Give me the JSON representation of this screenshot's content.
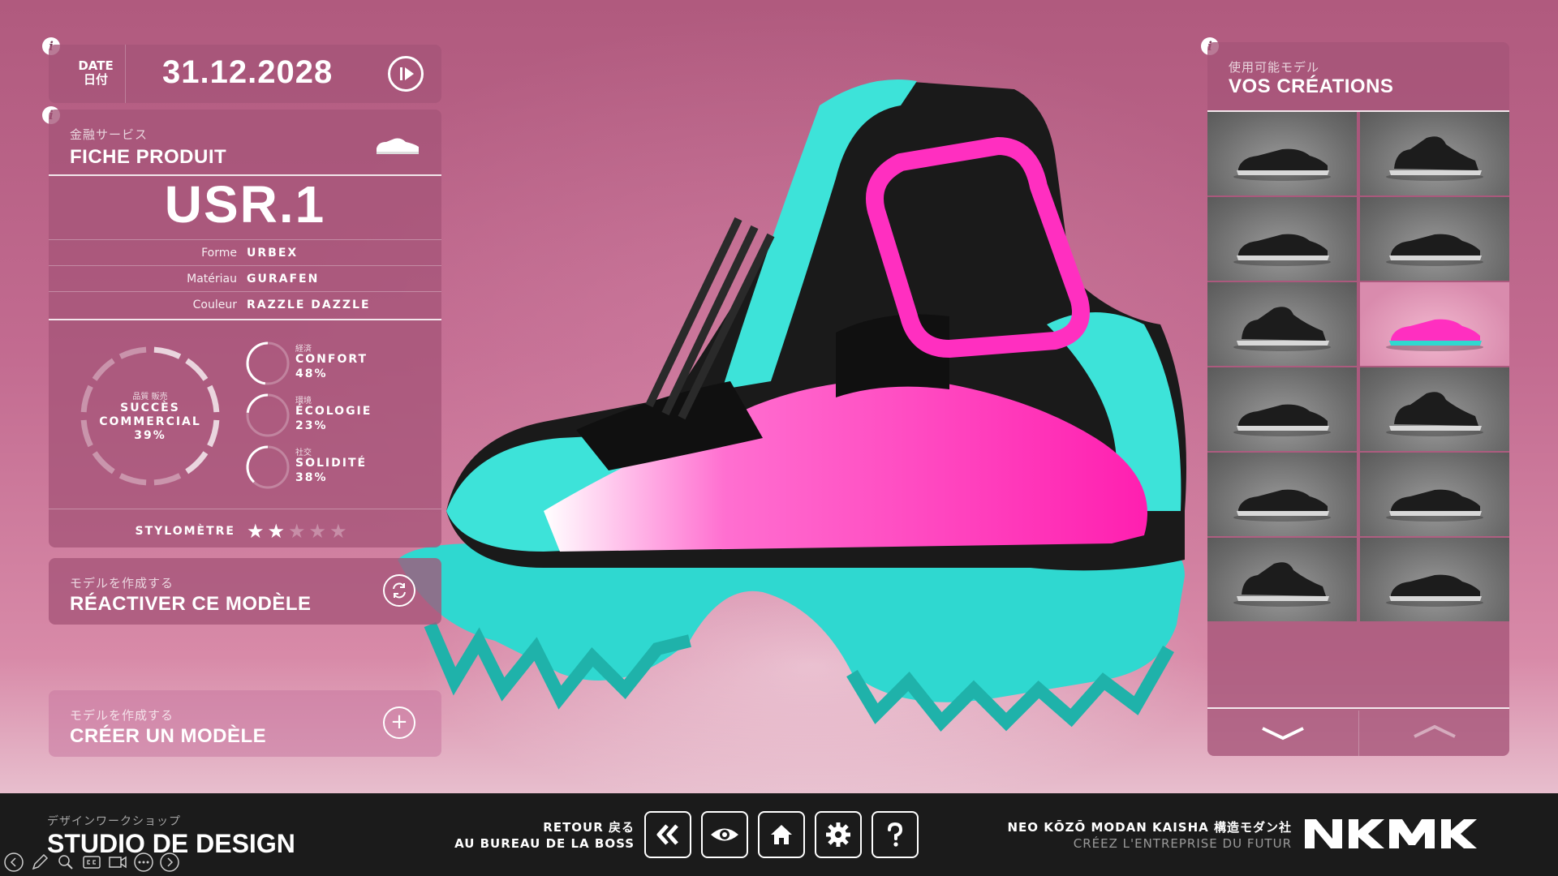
{
  "date": {
    "label": "DATE",
    "label_jp": "日付",
    "value": "31.12.2028"
  },
  "product": {
    "subtitle_jp": "金融サービス",
    "title": "FICHE PRODUIT",
    "model_name": "USR.1",
    "attributes": [
      {
        "key": "Forme",
        "value": "URBEX"
      },
      {
        "key": "Matériau",
        "value": "GURAFEN"
      },
      {
        "key": "Couleur",
        "value": "RAZZLE DAZZLE"
      }
    ],
    "main_stat": {
      "jp": "品質 販売",
      "line1": "SUCCÈS",
      "line2": "COMMERCIAL",
      "percent_label": "39%",
      "value": 39
    },
    "stats": [
      {
        "jp": "経済",
        "name": "CONFORT",
        "percent_label": "48%",
        "value": 48
      },
      {
        "jp": "環境",
        "name": "ÉCOLOGIE",
        "percent_label": "23%",
        "value": 23
      },
      {
        "jp": "社交",
        "name": "SOLIDITÉ",
        "percent_label": "38%",
        "value": 38
      }
    ],
    "stylometer": {
      "label": "STYLOMÈTRE",
      "rating": 2,
      "max": 5
    }
  },
  "reactivate": {
    "jp": "モデルを作成する",
    "label": "RÉACTIVER CE MODÈLE",
    "icon": "refresh-icon"
  },
  "create": {
    "jp": "モデルを作成する",
    "label": "CRÉER UN MODÈLE",
    "icon": "plus-icon"
  },
  "creations": {
    "jp": "使用可能モデル",
    "title": "VOS CRÉATIONS",
    "selected_index": 5,
    "count": 12
  },
  "bottom": {
    "studio_jp": "デザインワークショップ",
    "studio": "STUDIO DE DESIGN",
    "back_line1": "RETOUR 戻る",
    "back_line2": "AU BUREAU DE LA BOSS",
    "nav_icons": [
      "rewind-icon",
      "eye-icon",
      "home-icon",
      "gear-icon",
      "help-icon"
    ],
    "company_line1": "NEO KŌZŌ MODAN KAISHA 構造モダン社",
    "company_line2": "CRÉEZ L'ENTREPRISE DU FUTUR",
    "logo": "NKMK"
  },
  "colors": {
    "accent_pink": "#ff2fc0",
    "accent_teal": "#2fd8d0",
    "panel": "#a55578"
  }
}
